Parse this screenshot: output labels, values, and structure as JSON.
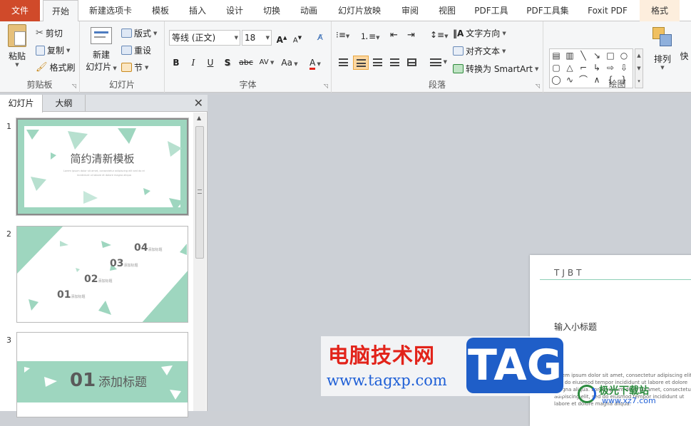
{
  "tabs": {
    "file": "文件",
    "items": [
      "开始",
      "新建选项卡",
      "模板",
      "插入",
      "设计",
      "切换",
      "动画",
      "幻灯片放映",
      "审阅",
      "视图",
      "PDF工具",
      "PDF工具集",
      "Foxit PDF",
      "格式"
    ],
    "active": "开始"
  },
  "clipboard": {
    "paste": "粘贴",
    "cut": "剪切",
    "copy": "复制",
    "format_painter": "格式刷",
    "group": "剪贴板"
  },
  "slides_group": {
    "new_slide_1": "新建",
    "new_slide_2": "幻灯片",
    "layout": "版式",
    "reset": "重设",
    "section": "节",
    "group": "幻灯片"
  },
  "font": {
    "family": "等线 (正文)",
    "size": "18",
    "bold": "B",
    "italic": "I",
    "underline": "U",
    "shadow": "S",
    "strike": "abc",
    "spacing": "AV",
    "case": "Aa",
    "color_letter": "A",
    "grow": "A",
    "shrink": "A",
    "group": "字体"
  },
  "paragraph": {
    "text_direction": "文字方向",
    "align_text": "对齐文本",
    "smartart": "转换为 SmartArt",
    "group": "段落"
  },
  "drawing": {
    "arrange": "排列",
    "quick_styles": "快",
    "group": "绘图"
  },
  "pane": {
    "tab_slides": "幻灯片",
    "tab_outline": "大纲",
    "close": "✕",
    "slides": [
      {
        "num": "1",
        "title": "简约清新模板",
        "body_1": "Lorem ipsum dolor sit amet, consectetur adipiscing elit sed do eiusmod tempor",
        "body_2": "incididunt ut labore et dolore magna aliqua"
      },
      {
        "num": "2",
        "items": [
          {
            "n": "04",
            "label": "添加标题"
          },
          {
            "n": "03",
            "label": "添加标题"
          },
          {
            "n": "02",
            "label": "添加标题"
          },
          {
            "n": "01",
            "label": "添加标题"
          }
        ]
      },
      {
        "num": "3",
        "n": "01",
        "title": "添加标题"
      }
    ]
  },
  "main_slide": {
    "tag": "TJBT",
    "subtitle": "输入小标题",
    "body": "Lorem ipsum dolor sit amet, consectetur adipiscing elit, sed do eiusmod tempor incididunt ut labore et dolore magna aliqua. Lorem ipsum dolor sit amet, consectetur adipiscing elit, sed do eiusmod tempor incididunt ut labore et dolore magna aliqua."
  },
  "watermark": {
    "cn": "电脑技术网",
    "url": "www.tagxp.com",
    "tag": "TAG",
    "logo_text": "极光下载站",
    "logo_url": "www.xz7.com"
  },
  "colors": {
    "accent": "#d04a2a",
    "mint": "#8fcfb7",
    "selection": "#fcd7a0",
    "font_red": "#e2231a"
  }
}
